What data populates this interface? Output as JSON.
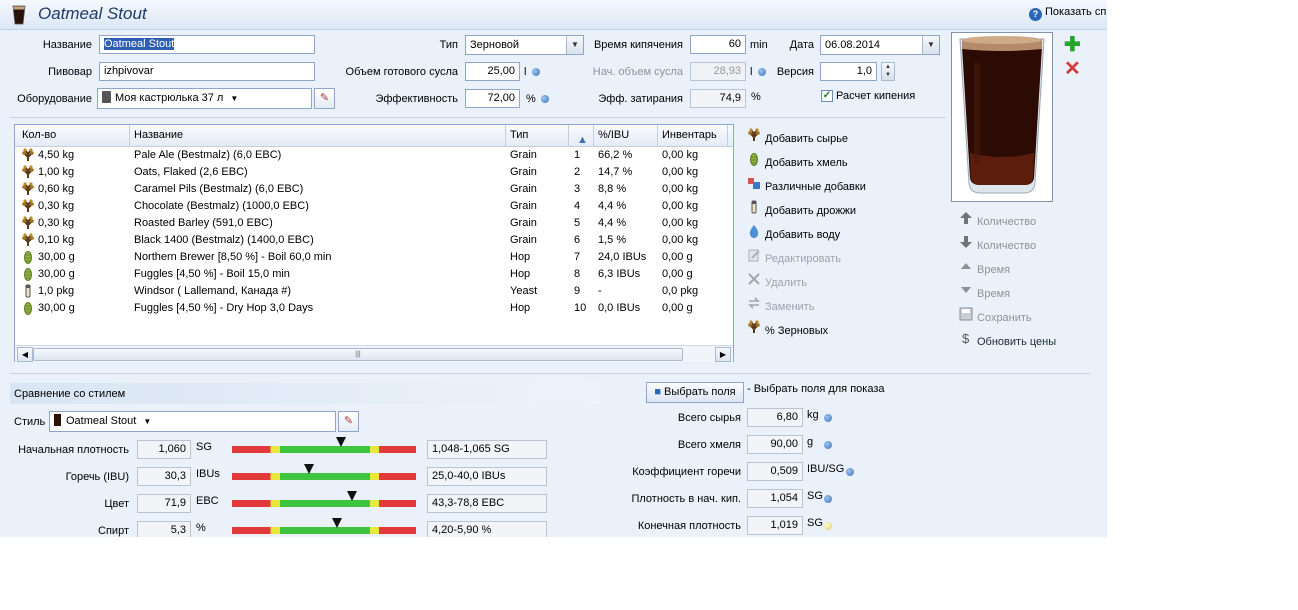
{
  "window": {
    "title": "Oatmeal Stout",
    "help_label": "Показать сп"
  },
  "recipe": {
    "name_label": "Название",
    "name_value": "Oatmeal Stout",
    "brewer_label": "Пивовар",
    "brewer_value": "izhpivovar",
    "equipment_label": "Оборудование",
    "equipment_value": "Моя кастрюлька 37 л",
    "type_label": "Тип",
    "type_value": "Зерновой",
    "batch_label": "Объем готового сусла",
    "batch_value": "25,00",
    "batch_unit": "l",
    "efficiency_label": "Эффективность",
    "efficiency_value": "72,00",
    "efficiency_unit": "%",
    "boil_time_label": "Время кипячения",
    "boil_time_value": "60",
    "boil_time_unit": "min",
    "boil_volume_label": "Нач. объем сусла",
    "boil_volume_value": "28,93",
    "boil_volume_unit": "l",
    "mash_eff_label": "Эфф. затирания",
    "mash_eff_value": "74,9",
    "mash_eff_unit": "%",
    "date_label": "Дата",
    "date_value": "06.08.2014",
    "version_label": "Версия",
    "version_value": "1,0",
    "boil_calc_label": "Расчет кипения",
    "boil_calc_checked": true
  },
  "ingredients": {
    "columns": [
      "Кол-во",
      "Название",
      "Тип",
      "",
      "%/IBU",
      "Инвентарь"
    ],
    "rows": [
      {
        "icon": "grain-icon",
        "qty": "4,50 kg",
        "name": "Pale Ale (Bestmalz) (6,0 EBC)",
        "type": "Grain",
        "order": "1",
        "pct": "66,2 %",
        "inv": "0,00 kg"
      },
      {
        "icon": "grain-icon",
        "qty": "1,00 kg",
        "name": "Oats, Flaked (2,6 EBC)",
        "type": "Grain",
        "order": "2",
        "pct": "14,7 %",
        "inv": "0,00 kg"
      },
      {
        "icon": "grain-icon",
        "qty": "0,60 kg",
        "name": "Caramel Pils (Bestmalz) (6,0 EBC)",
        "type": "Grain",
        "order": "3",
        "pct": "8,8 %",
        "inv": "0,00 kg"
      },
      {
        "icon": "grain-icon",
        "qty": "0,30 kg",
        "name": "Chocolate (Bestmalz) (1000,0 EBC)",
        "type": "Grain",
        "order": "4",
        "pct": "4,4 %",
        "inv": "0,00 kg"
      },
      {
        "icon": "grain-icon",
        "qty": "0,30 kg",
        "name": "Roasted Barley (591,0 EBC)",
        "type": "Grain",
        "order": "5",
        "pct": "4,4 %",
        "inv": "0,00 kg"
      },
      {
        "icon": "grain-icon",
        "qty": "0,10 kg",
        "name": "Black 1400 (Bestmalz) (1400,0 EBC)",
        "type": "Grain",
        "order": "6",
        "pct": "1,5 %",
        "inv": "0,00 kg"
      },
      {
        "icon": "hop-icon",
        "qty": "30,00 g",
        "name": "Northern Brewer [8,50 %] - Boil 60,0 min",
        "type": "Hop",
        "order": "7",
        "pct": "24,0 IBUs",
        "inv": "0,00 g"
      },
      {
        "icon": "hop-icon",
        "qty": "30,00 g",
        "name": "Fuggles [4,50 %] - Boil 15,0 min",
        "type": "Hop",
        "order": "8",
        "pct": "6,3 IBUs",
        "inv": "0,00 g"
      },
      {
        "icon": "yeast-icon",
        "qty": "1,0 pkg",
        "name": "Windsor ( Lallemand, Канада #)",
        "type": "Yeast",
        "order": "9",
        "pct": "-",
        "inv": "0,0 pkg"
      },
      {
        "icon": "hop-icon",
        "qty": "30,00 g",
        "name": "Fuggles [4,50 %] - Dry Hop 3,0 Days",
        "type": "Hop",
        "order": "10",
        "pct": "0,0 IBUs",
        "inv": "0,00 g"
      }
    ]
  },
  "actions": [
    {
      "icon": "grain-icon",
      "label": "Добавить сырье",
      "enabled": true
    },
    {
      "icon": "hop-icon",
      "label": "Добавить хмель",
      "enabled": true
    },
    {
      "icon": "misc-icon",
      "label": "Различные добавки",
      "enabled": true
    },
    {
      "icon": "yeast-icon",
      "label": "Добавить дрожжи",
      "enabled": true
    },
    {
      "icon": "water-drop-icon",
      "label": "Добавить воду",
      "enabled": true
    },
    {
      "icon": "edit-icon",
      "label": "Редактировать",
      "enabled": false
    },
    {
      "icon": "delete-icon",
      "label": "Удалить",
      "enabled": false
    },
    {
      "icon": "replace-icon",
      "label": "Заменить",
      "enabled": false
    },
    {
      "icon": "grain-icon",
      "label": "% Зерновых",
      "enabled": true
    }
  ],
  "side_actions": [
    {
      "icon": "arrow-up-icon",
      "label": "Количество"
    },
    {
      "icon": "arrow-down-icon",
      "label": "Количество"
    },
    {
      "icon": "triangle-up-icon",
      "label": "Время"
    },
    {
      "icon": "triangle-down-icon",
      "label": "Время"
    },
    {
      "icon": "save-icon",
      "label": "Сохранить"
    },
    {
      "icon": "dollar-icon",
      "label": "Обновить цены"
    }
  ],
  "style": {
    "section_title": "Сравнение со стилем",
    "style_label": "Стиль",
    "style_value": "Oatmeal Stout",
    "metrics": [
      {
        "label": "Начальная плотность",
        "value": "1,060",
        "unit": "SG",
        "range": "1,048-1,065 SG",
        "marker": 0.59
      },
      {
        "label": "Горечь (IBU)",
        "value": "30,3",
        "unit": "IBUs",
        "range": "25,0-40,0 IBUs",
        "marker": 0.42
      },
      {
        "label": "Цвет",
        "value": "71,9",
        "unit": "EBC",
        "range": "43,3-78,8 EBC",
        "marker": 0.65
      },
      {
        "label": "Спирт",
        "value": "5,3",
        "unit": "%",
        "range": "4,20-5,90 %",
        "marker": 0.57
      }
    ]
  },
  "fields": {
    "choose_button": "Выбрать поля",
    "choose_hint": "- Выбрать поля для показа",
    "rows": [
      {
        "label": "Всего сырья",
        "value": "6,80",
        "unit": "kg",
        "dot": "blue"
      },
      {
        "label": "Всего хмеля",
        "value": "90,00",
        "unit": "g",
        "dot": "blue"
      },
      {
        "label": "Коэффициент горечи",
        "value": "0,509",
        "unit": "IBU/SG",
        "dot": "blue"
      },
      {
        "label": "Плотность в нач. кип.",
        "value": "1,054",
        "unit": "SG",
        "dot": "blue"
      },
      {
        "label": "Конечная плотность",
        "value": "1,019",
        "unit": "SG",
        "dot": "yellow"
      }
    ]
  }
}
